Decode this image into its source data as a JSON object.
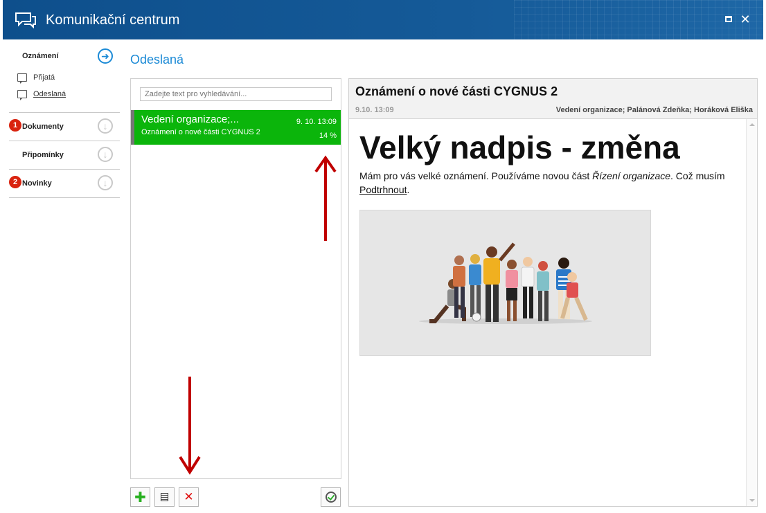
{
  "window": {
    "title": "Komunikační centrum",
    "maximize_icon": "maximize-icon",
    "close_icon": "close-icon",
    "close_glyph": "✕"
  },
  "nav": {
    "announcements": {
      "label": "Oznámení"
    },
    "received": {
      "label": "Přijatá"
    },
    "sent": {
      "label": "Odeslaná"
    },
    "documents": {
      "label": "Dokumenty",
      "badge": "1"
    },
    "reminders": {
      "label": "Připomínky"
    },
    "news": {
      "label": "Novinky",
      "badge": "2"
    }
  },
  "section_title": "Odeslaná",
  "search": {
    "placeholder": "Zadejte text pro vyhledávání..."
  },
  "messages": [
    {
      "from": "Vedení organizace;...",
      "date": "9. 10.  13:09",
      "subject": "Oznámení o nové části CYGNUS 2",
      "progress": "14 %"
    }
  ],
  "detail": {
    "subject": "Oznámení o nové části CYGNUS 2",
    "date": "9.10. 13:09",
    "recipients": "Vedení organizace; Palánová Zdeňka; Horáková Eliška",
    "heading": "Velký nadpis - změna",
    "text_start": "Mám pro vás velké oznámení. Používáme novou část ",
    "text_italic": "Řízení organizace",
    "text_mid": ". Což musím ",
    "text_underline": "Podtrhnout",
    "text_end": "."
  },
  "colors": {
    "titlebar": "#155a98",
    "accent": "#1b8ad6",
    "selected_item": "#0bb50b",
    "badge": "#d9230f",
    "annotation_arrow": "#c00000"
  }
}
